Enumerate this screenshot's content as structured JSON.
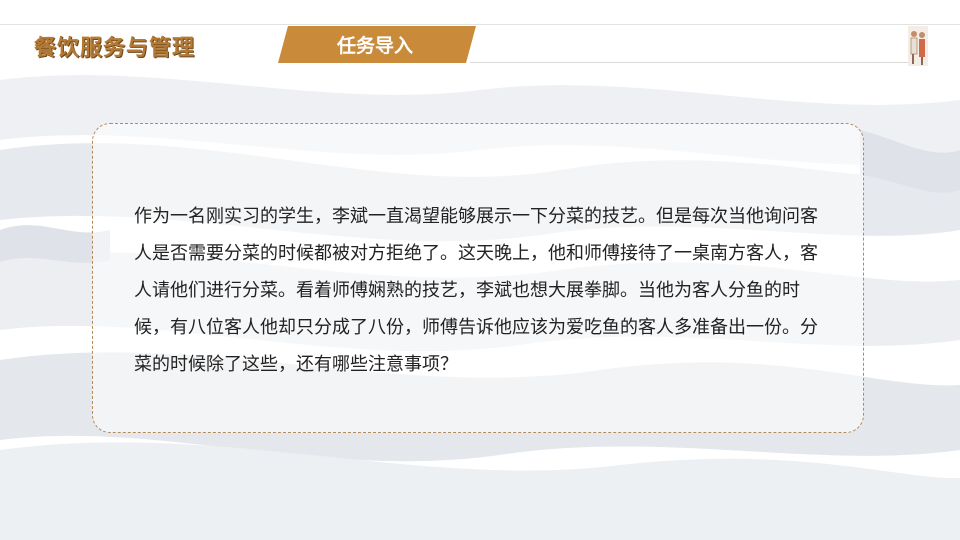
{
  "header": {
    "title": "餐饮服务与管理",
    "section_tab": "任务导入"
  },
  "content": {
    "paragraph": "作为一名刚实习的学生，李斌一直渴望能够展示一下分菜的技艺。但是每次当他询问客人是否需要分菜的时候都被对方拒绝了。这天晚上，他和师傅接待了一桌南方客人，客人请他们进行分菜。看着师傅娴熟的技艺，李斌也想大展拳脚。当他为客人分鱼的时候，有八位客人他却只分成了八份，师傅告诉他应该为爱吃鱼的客人多准备出一份。分菜的时候除了这些，还有哪些注意事项？"
  },
  "colors": {
    "accent": "#c98a3a",
    "title": "#b47a35",
    "box_border": "#b48a5a",
    "text": "#222222"
  }
}
